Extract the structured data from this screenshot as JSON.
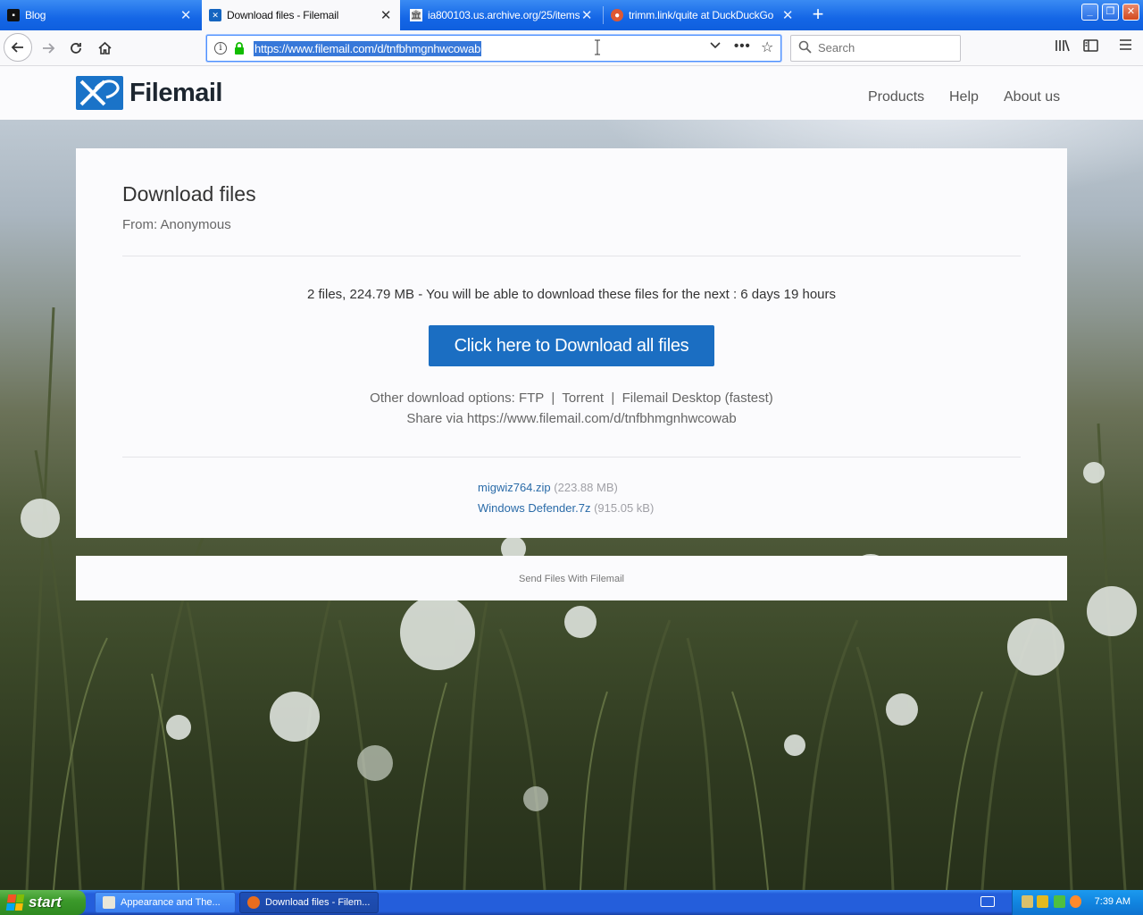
{
  "browser": {
    "tabs": [
      {
        "title": "Blog",
        "active": false,
        "icon": "blog-favicon-icon"
      },
      {
        "title": "Download files - Filemail",
        "active": true,
        "icon": "filemail-favicon-icon"
      },
      {
        "title": "ia800103.us.archive.org/25/items",
        "active": false,
        "icon": "archive-favicon-icon"
      },
      {
        "title": "trimm.link/quite at DuckDuckGo",
        "active": false,
        "icon": "duckduckgo-favicon-icon"
      }
    ],
    "url": "https://www.filemail.com/d/tnfbhmgnhwcowab",
    "search_placeholder": "Search",
    "window_controls": {
      "minimize": "_",
      "maximize": "❐",
      "close": "✕"
    }
  },
  "site": {
    "logo_text": "Filemail",
    "nav": [
      "Products",
      "Help",
      "About us"
    ],
    "brand_color": "#1b6ec2"
  },
  "download": {
    "title": "Download files",
    "from": "From: Anonymous",
    "summary": "2 files, 224.79 MB - You will be able to download these files for the next : 6 days 19 hours",
    "button_label": "Click here to Download all files",
    "other_prefix": "Other download options: ",
    "other_options": [
      "FTP",
      "Torrent",
      "Filemail Desktop (fastest)"
    ],
    "share_prefix": "Share via ",
    "share_url": "https://www.filemail.com/d/tnfbhmgnhwcowab",
    "files": [
      {
        "name": "migwiz764.zip",
        "size": "(223.88 MB)"
      },
      {
        "name": "Windows Defender.7z",
        "size": "(915.05 kB)"
      }
    ],
    "footer": "Send Files With Filemail"
  },
  "taskbar": {
    "start_label": "start",
    "items": [
      {
        "label": "Appearance and The...",
        "active": false
      },
      {
        "label": "Download files - Filem...",
        "active": true
      }
    ],
    "clock": "7:39 AM"
  }
}
